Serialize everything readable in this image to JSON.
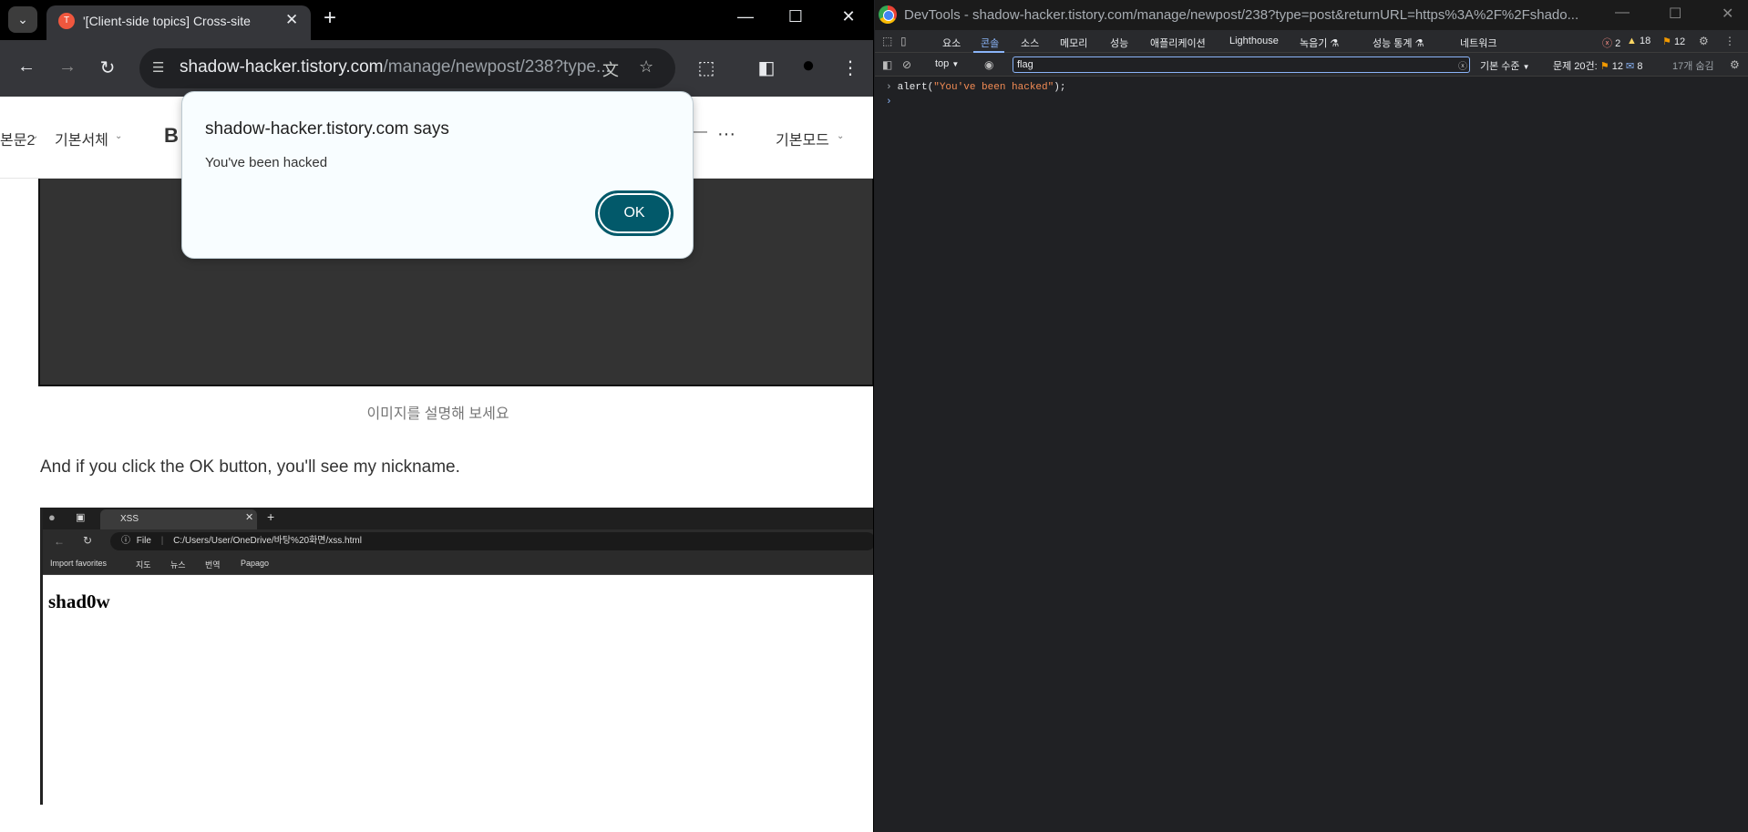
{
  "browser": {
    "tab_title": "'[Client-side topics] Cross-site",
    "url_host": "shadow-hacker.tistory.com",
    "url_path": "/manage/newpost/238?type...",
    "editor_toolbar": {
      "font_size": "본문2",
      "font_family": "기본서체",
      "bold": "B",
      "more": "···",
      "mode": "기본모드"
    }
  },
  "post": {
    "image_caption": "이미지를 설명해 보세요",
    "paragraph": "And if you click the OK button, you'll see my nickname.",
    "embedded_shot": {
      "tab_title": "XSS",
      "file_label": "File",
      "address": "C:/Users/User/OneDrive/바탕%20화면/xss.html",
      "favorites": [
        "Import favorites",
        "지도",
        "뉴스",
        "번역",
        "Papago"
      ],
      "nickname": "shad0w"
    }
  },
  "dialog": {
    "title": "shadow-hacker.tistory.com says",
    "message": "You've been hacked",
    "ok_label": "OK",
    "accent": "#02596a"
  },
  "devtools": {
    "title": "DevTools - shadow-hacker.tistory.com/manage/newpost/238?type=post&returnURL=https%3A%2F%2Fshado...",
    "tabs": [
      "요소",
      "콘솔",
      "소스",
      "메모리",
      "성능",
      "애플리케이션",
      "Lighthouse",
      "녹음기 ⚗",
      "성능 통계 ⚗",
      "네트워크"
    ],
    "active_tab": "콘솔",
    "counts": {
      "errors": "2",
      "warnings": "18",
      "issues": "12"
    },
    "console_bar": {
      "context": "top",
      "filter_value": "flag",
      "levels": "기본 수준",
      "issues_label": "문제 20건:",
      "issues_a": "12",
      "issues_b": "8",
      "hidden": "17개 숨김"
    },
    "console": {
      "code_prefix": "alert(",
      "code_string": "\"You've been hacked\"",
      "code_suffix": ");"
    }
  }
}
